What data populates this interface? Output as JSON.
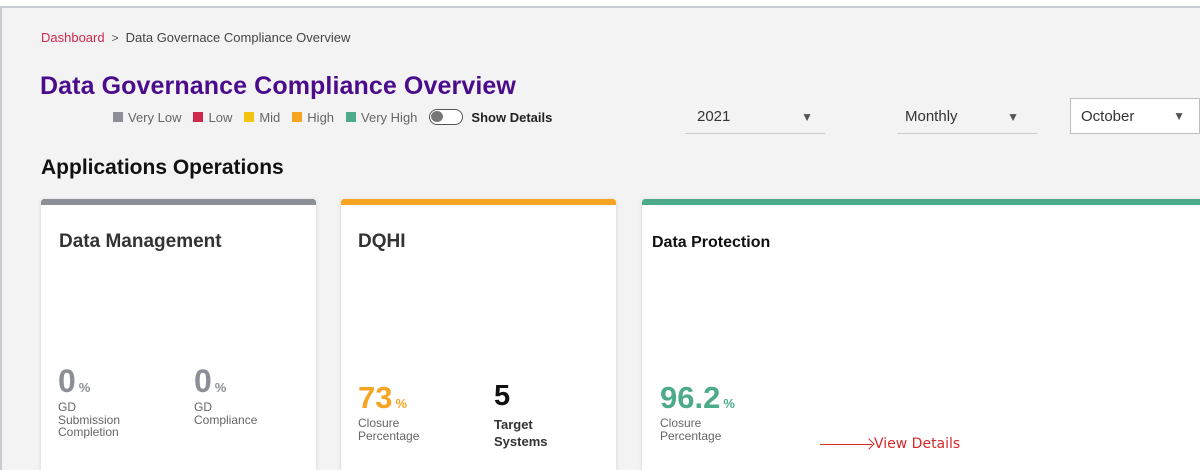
{
  "breadcrumb": {
    "home": "Dashboard",
    "separator": ">",
    "current": "Data Governace Compliance Overview"
  },
  "page_title": "Data Governance Compliance Overview",
  "legend": {
    "items": [
      {
        "label": "Very Low",
        "color": "#8c8f96"
      },
      {
        "label": "Low",
        "color": "#d0284c"
      },
      {
        "label": "Mid",
        "color": "#f2c40f"
      },
      {
        "label": "High",
        "color": "#f5a522"
      },
      {
        "label": "Very High",
        "color": "#4dab8a"
      }
    ],
    "toggle_label": "Show Details",
    "toggle_on": false
  },
  "filters": {
    "year": "2021",
    "period": "Monthly",
    "month": "October"
  },
  "section_title": "Applications Operations",
  "cards": {
    "data_management": {
      "title": "Data Management",
      "bar_color": "#8c8f96",
      "metrics": [
        {
          "value": "0",
          "unit": "%",
          "label_1": "GD",
          "label_2": "Submission",
          "label_3": "Completion"
        },
        {
          "value": "0",
          "unit": "%",
          "label_1": "GD",
          "label_2": "Compliance"
        }
      ]
    },
    "dqhi": {
      "title": "DQHI",
      "bar_color": "#f5a522",
      "metrics": [
        {
          "value": "73",
          "unit": "%",
          "label_1": "Closure",
          "label_2": "Percentage"
        },
        {
          "value": "5",
          "label_1": "Target",
          "label_2": "Systems"
        }
      ]
    },
    "data_protection": {
      "title": "Data Protection",
      "bar_color": "#4dab8a",
      "metrics": [
        {
          "value": "96.2",
          "unit": "%",
          "label_1": "Closure",
          "label_2": "Percentage"
        }
      ],
      "view_details": "View Details"
    }
  }
}
